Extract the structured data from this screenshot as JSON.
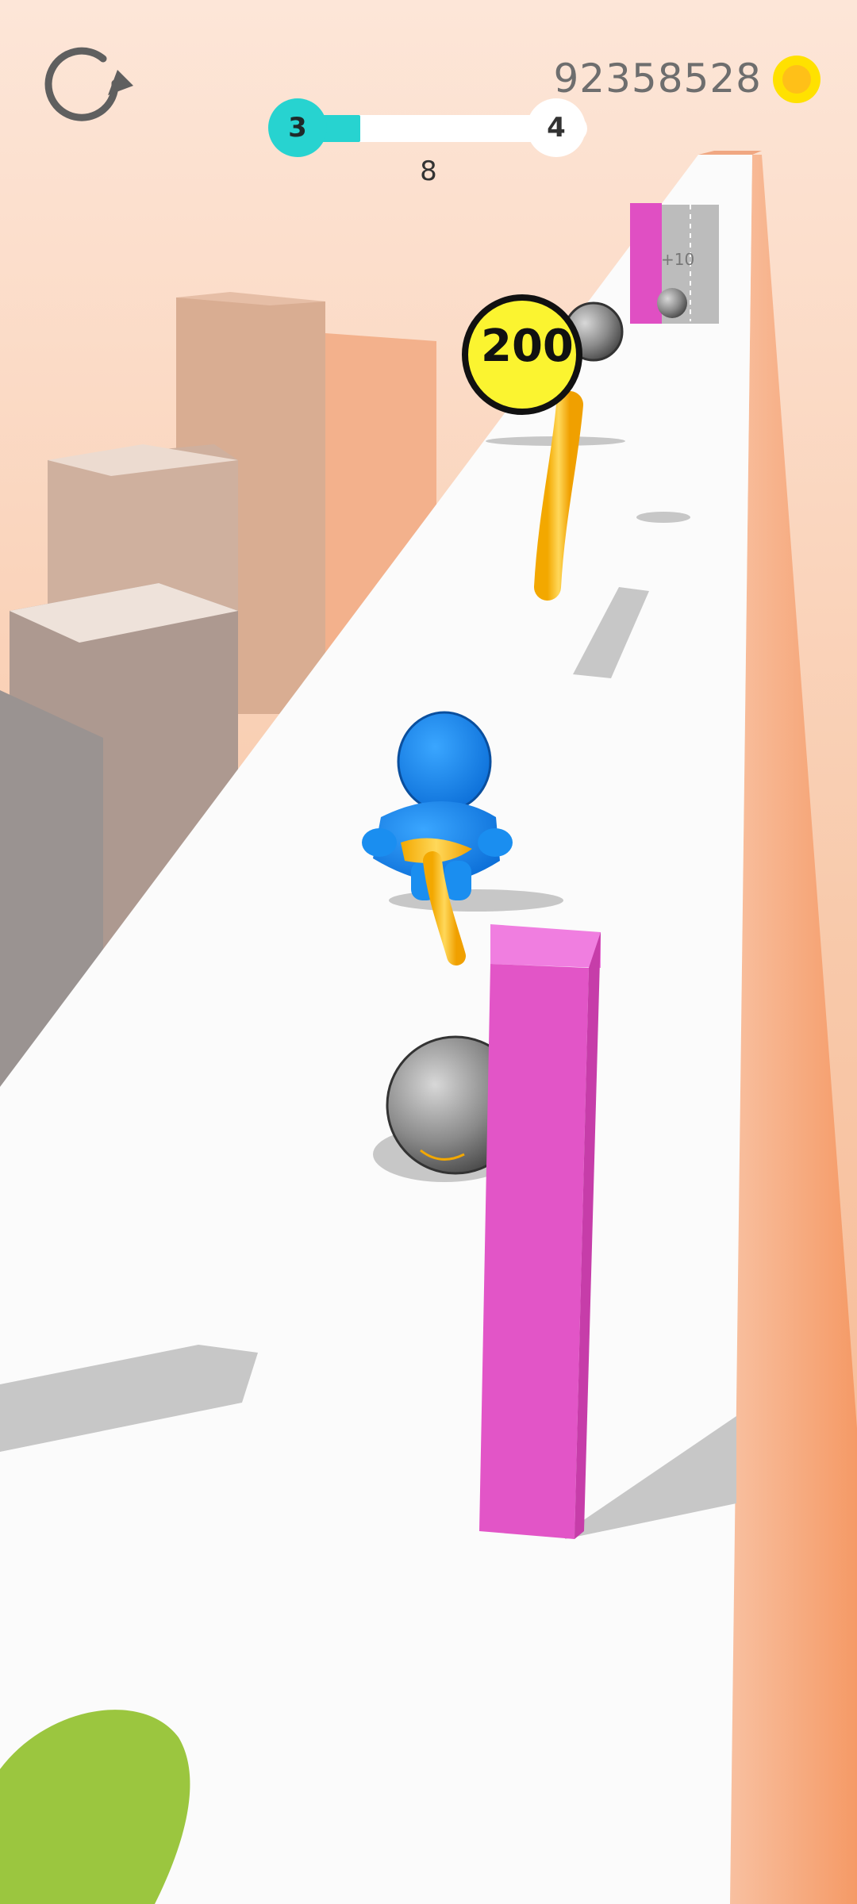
{
  "hud": {
    "coins": "92358528",
    "level_current": "3",
    "level_next": "4",
    "progress_count": "8",
    "level_progress_fraction": 0.12,
    "restart_icon": "restart-icon",
    "coin_icon": "coin-icon"
  },
  "world": {
    "bonus_circle_value": "200",
    "gate_label": "+10"
  },
  "colors": {
    "accent": "#27d3d0",
    "coin": "#ffc018",
    "player": "#1a8ef0",
    "rope": "#f5b820",
    "wall": "#e255c7",
    "joystick": "#9bc63f"
  }
}
